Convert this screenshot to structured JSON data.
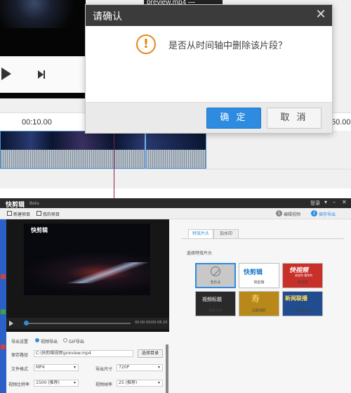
{
  "editor": {
    "filename": "preview.mp4 — 00:59:12",
    "ruler_ticks": [
      "00:10.00",
      "50.00"
    ]
  },
  "dialog": {
    "title": "请确认",
    "close_icon": "close-icon",
    "message": "是否从时间轴中删除该片段？",
    "warning_icon": "!",
    "ok_label": "确 定",
    "cancel_label": "取 消",
    "accent_color": "#2d8ce0"
  },
  "app": {
    "logo": "快剪辑",
    "beta": "Beta",
    "login": "登录",
    "toolbar": {
      "new_project": "新建项目",
      "my_projects": "我的项目"
    },
    "steps": [
      {
        "num": "1",
        "label": "编辑视频"
      },
      {
        "num": "2",
        "label": "保存导出"
      }
    ],
    "preview": {
      "logo": "快剪辑",
      "time": "00:00.00/00:08.20"
    },
    "export": {
      "setting_label": "导出设置",
      "opt_video": "视频导出",
      "opt_gif": "GIF导出",
      "path_label": "保存路径",
      "path_value": "C:\\快剪辑视频\\preview.mp4",
      "browse_label": "选择目录",
      "format_label": "文件格式",
      "format_value": "MP4",
      "size_label": "导出尺寸",
      "size_value": "720P",
      "bitrate_label": "视频比特率",
      "bitrate_value": "1500 (推荐)",
      "fps_label": "视频帧率",
      "fps_value": "25 (推荐)"
    },
    "right": {
      "tab_intro": "特效片头",
      "tab_watermark": "加水印",
      "section_title": "选择特效片头",
      "templates": [
        {
          "name": "无片头",
          "art": ""
        },
        {
          "name": "快剪辑",
          "art": "快剪辑"
        },
        {
          "name": "快视频",
          "art": "快视频",
          "sub": "说说你 看你的"
        },
        {
          "name": "黑底白字",
          "art": "视频标题"
        },
        {
          "name": "古韵流彩",
          "art": "寿"
        },
        {
          "name": "新闻联播",
          "art": "新闻联播"
        }
      ]
    }
  }
}
